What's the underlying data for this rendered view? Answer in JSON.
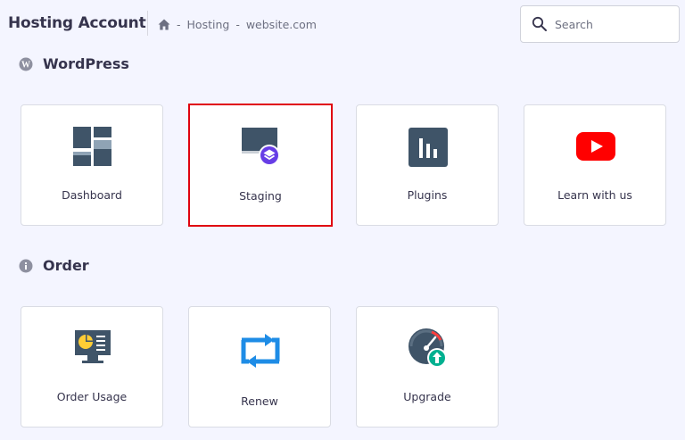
{
  "header": {
    "title": "Hosting Account",
    "breadcrumb": [
      "Hosting",
      "website.com"
    ],
    "breadcrumb_separator": "-",
    "search_placeholder": "Search"
  },
  "sections": [
    {
      "title": "WordPress",
      "icon": "wordpress-icon",
      "cards": [
        {
          "label": "Dashboard",
          "icon": "dashboard-icon"
        },
        {
          "label": "Staging",
          "icon": "staging-icon",
          "highlighted": true
        },
        {
          "label": "Plugins",
          "icon": "plugins-icon"
        },
        {
          "label": "Learn with us",
          "icon": "youtube-icon"
        }
      ]
    },
    {
      "title": "Order",
      "icon": "info-icon",
      "cards": [
        {
          "label": "Order Usage",
          "icon": "order-usage-icon"
        },
        {
          "label": "Renew",
          "icon": "renew-icon"
        },
        {
          "label": "Upgrade",
          "icon": "upgrade-icon"
        }
      ]
    }
  ],
  "colors": {
    "background": "#f4f5ff",
    "card_border": "#dadce4",
    "highlight_border": "#e0000f",
    "icon_slate": "#3f5468",
    "icon_blue": "#1e8ce6",
    "youtube_red": "#ff0000",
    "staging_badge": "#673de6",
    "upgrade_green": "#00b090",
    "order_usage_yellow": "#ffcd35"
  }
}
